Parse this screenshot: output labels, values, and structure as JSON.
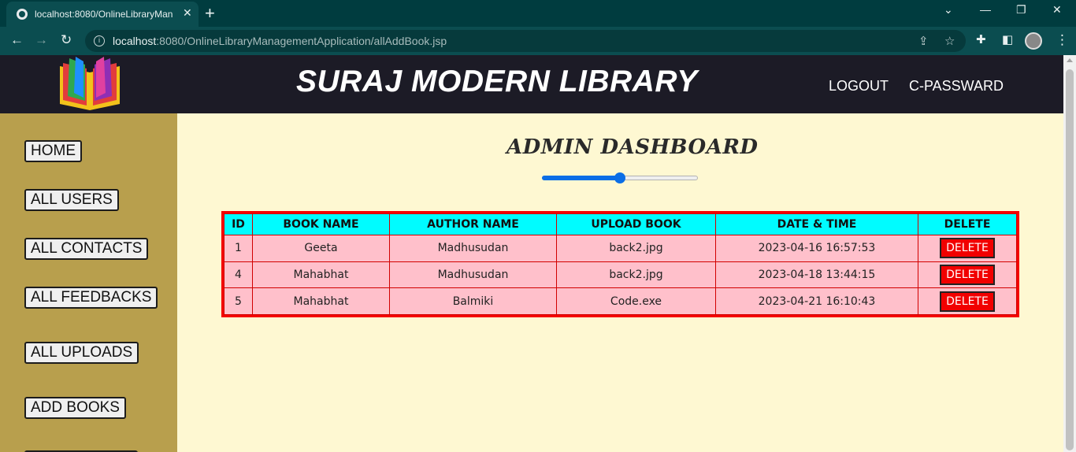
{
  "browser": {
    "tab_title": "localhost:8080/OnlineLibraryMan",
    "url_host": "localhost",
    "url_rest": ":8080/OnlineLibraryManagementApplication/allAddBook.jsp"
  },
  "header": {
    "brand": "SURAJ MODERN LIBRARY",
    "nav": [
      "LOGOUT",
      "C-PASSWARD"
    ]
  },
  "sidebar": {
    "items": [
      "HOME",
      "ALL USERS",
      "ALL CONTACTS",
      "ALL FEEDBACKS",
      "ALL UPLOADS",
      "ADD BOOKS"
    ]
  },
  "main": {
    "title": "ADMIN DASHBOARD",
    "slider_value": 0.5
  },
  "table": {
    "headers": [
      "ID",
      "BOOK NAME",
      "AUTHOR NAME",
      "UPLOAD BOOK",
      "DATE & TIME",
      "DELETE"
    ],
    "rows": [
      {
        "id": "1",
        "book": "Geeta",
        "author": "Madhusudan",
        "file": "back2.jpg",
        "datetime": "2023-04-16 16:57:53",
        "action": "DELETE"
      },
      {
        "id": "4",
        "book": "Mahabhat",
        "author": "Madhusudan",
        "file": "back2.jpg",
        "datetime": "2023-04-18 13:44:15",
        "action": "DELETE"
      },
      {
        "id": "5",
        "book": "Mahabhat",
        "author": "Balmiki",
        "file": "Code.exe",
        "datetime": "2023-04-21 16:10:43",
        "action": "DELETE"
      }
    ]
  },
  "colors": {
    "header_bg": "#1c1b26",
    "sidebar_bg": "#b89f4d",
    "page_bg": "#fef8d2",
    "table_header_bg": "#00fcff",
    "table_row_bg": "#ffc0cb",
    "delete_bg": "#f10000"
  }
}
